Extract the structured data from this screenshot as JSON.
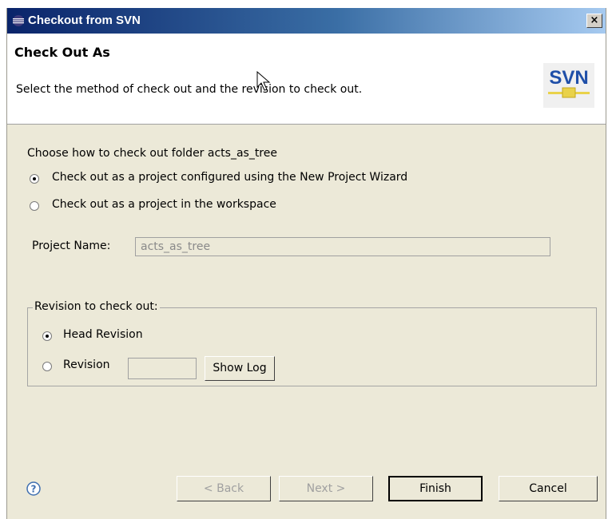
{
  "window": {
    "title": "Checkout from SVN",
    "close_glyph": "×"
  },
  "header": {
    "title": "Check Out As",
    "description": "Select the method of check out and the revision to check out.",
    "logo_text": "SVN"
  },
  "content": {
    "prompt": "Choose how to check out folder acts_as_tree",
    "options": [
      {
        "label": "Check out as a project configured using the New Project Wizard",
        "selected": true
      },
      {
        "label": "Check out as a project in the workspace",
        "selected": false
      }
    ],
    "project_name_label": "Project Name:",
    "project_name_value": "acts_as_tree"
  },
  "revision": {
    "legend": "Revision to check out:",
    "head_label": "Head Revision",
    "head_selected": true,
    "revision_label": "Revision",
    "revision_selected": false,
    "revision_value": "",
    "show_log_label": "Show Log"
  },
  "buttons": {
    "back": "< Back",
    "next": "Next >",
    "finish": "Finish",
    "cancel": "Cancel"
  },
  "colors": {
    "titlebar_start": "#0a246a",
    "titlebar_end": "#a6caf0",
    "dialog_bg": "#ece9d8",
    "logo_blue": "#1f4fa8",
    "logo_yellow": "#e9d24a"
  }
}
